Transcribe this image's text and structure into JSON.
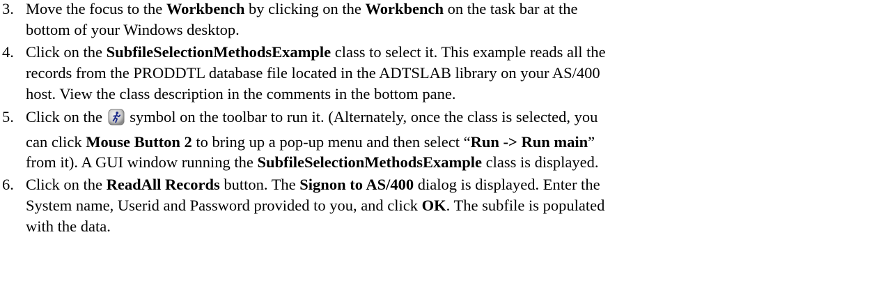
{
  "steps": [
    {
      "number": "3.",
      "lines": [
        [
          {
            "t": "Move the focus to the ",
            "b": false
          },
          {
            "t": "Workbench",
            "b": true
          },
          {
            "t": " by clicking on the ",
            "b": false
          },
          {
            "t": "Workbench",
            "b": true
          },
          {
            "t": " on the task bar at the",
            "b": false
          }
        ],
        [
          {
            "t": "bottom of your Windows desktop.",
            "b": false
          }
        ]
      ]
    },
    {
      "number": "4.",
      "lines": [
        [
          {
            "t": "Click on the ",
            "b": false
          },
          {
            "t": "SubfileSelectionMethodsExample",
            "b": true
          },
          {
            "t": " class to select it.  This example reads all the",
            "b": false
          }
        ],
        [
          {
            "t": "records from the PRODDTL database file located in the ADTSLAB library on your AS/400",
            "b": false
          }
        ],
        [
          {
            "t": "host.  View the class description in the comments in the bottom pane.",
            "b": false
          }
        ]
      ]
    },
    {
      "number": "5.",
      "lines": [
        [
          {
            "t": "Click on the ",
            "b": false
          },
          {
            "icon": "run-icon"
          },
          {
            "t": " symbol on the toolbar to run it.  (Alternately, once the class is selected, you",
            "b": false
          }
        ],
        [
          {
            "t": "can click ",
            "b": false
          },
          {
            "t": "Mouse Button 2",
            "b": true
          },
          {
            "t": " to bring up a pop-up menu and then select “",
            "b": false
          },
          {
            "t": "Run -> Run main",
            "b": true
          },
          {
            "t": "”",
            "b": false
          }
        ],
        [
          {
            "t": "from it).   A GUI window running the ",
            "b": false
          },
          {
            "t": "SubfileSelectionMethodsExample",
            "b": true
          },
          {
            "t": " class is displayed.",
            "b": false
          }
        ]
      ]
    },
    {
      "number": "6.",
      "lines": [
        [
          {
            "t": "Click on the ",
            "b": false
          },
          {
            "t": "ReadAll Records",
            "b": true
          },
          {
            "t": " button.  The ",
            "b": false
          },
          {
            "t": "Signon to AS/400",
            "b": true
          },
          {
            "t": " dialog is displayed.  Enter the",
            "b": false
          }
        ],
        [
          {
            "t": "System name, Userid and Password provided to you, and click ",
            "b": false
          },
          {
            "t": "OK",
            "b": true
          },
          {
            "t": ".  The subfile is populated",
            "b": false
          }
        ],
        [
          {
            "t": "with the data.",
            "b": false
          }
        ]
      ]
    }
  ]
}
